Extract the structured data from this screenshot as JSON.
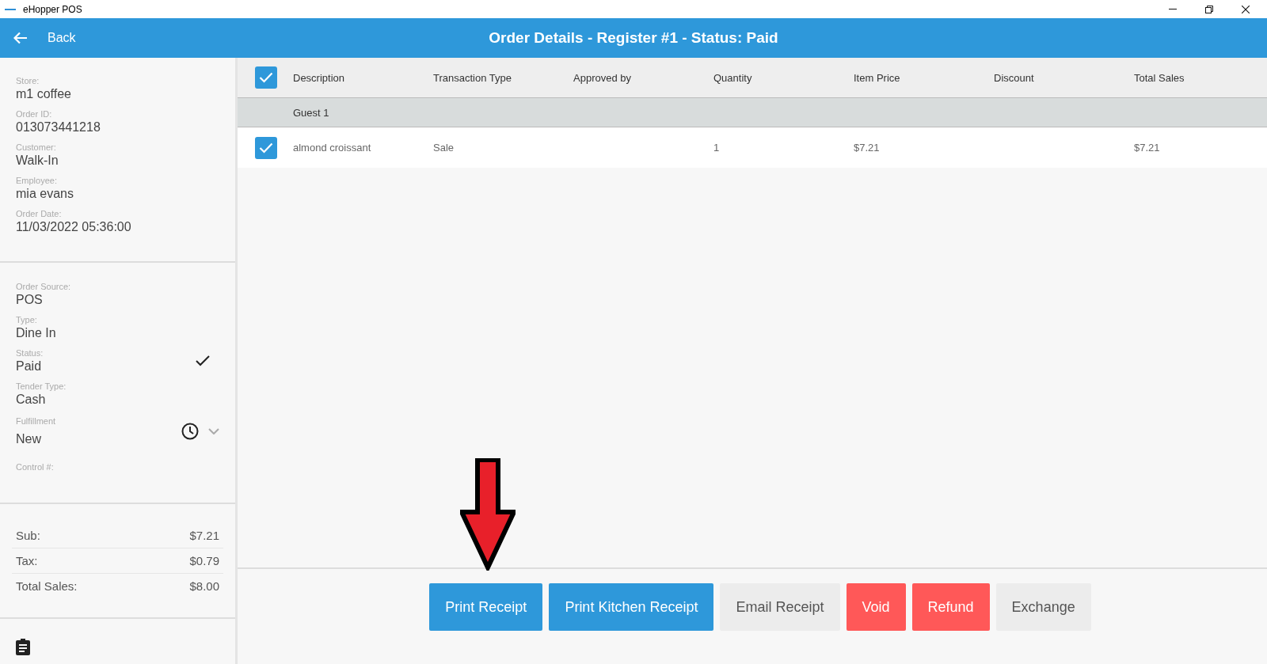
{
  "window": {
    "title": "eHopper POS"
  },
  "header": {
    "back": "Back",
    "title": "Order Details - Register #1 - Status: Paid"
  },
  "order_info": [
    {
      "label": "Store:",
      "value": "m1 coffee"
    },
    {
      "label": "Order ID:",
      "value": "013073441218"
    },
    {
      "label": "Customer:",
      "value": "Walk-In"
    },
    {
      "label": "Employee:",
      "value": "mia evans"
    },
    {
      "label": "Order Date:",
      "value": "11/03/2022 05:36:00"
    }
  ],
  "order_status": [
    {
      "label": "Order Source:",
      "value": "POS",
      "kind": "plain"
    },
    {
      "label": "Type:",
      "value": "Dine In",
      "kind": "plain"
    },
    {
      "label": "Status:",
      "value": "Paid",
      "kind": "check"
    },
    {
      "label": "Tender Type:",
      "value": "Cash",
      "kind": "plain"
    },
    {
      "label": "Fulfillment",
      "value": "New",
      "kind": "dropdown"
    },
    {
      "label": "Control #:",
      "kind": "plain"
    }
  ],
  "totals": [
    {
      "label": "Sub:",
      "value": "$7.21"
    },
    {
      "label": "Tax:",
      "value": "$0.79"
    },
    {
      "label": "Total Sales:",
      "value": "$8.00"
    }
  ],
  "table": {
    "select_all": {
      "checked": true
    },
    "columns": [
      "Description",
      "Transaction Type",
      "Approved by",
      "Quantity",
      "Item Price",
      "Discount",
      "Total Sales"
    ],
    "groups": [
      {
        "name": "Guest 1",
        "rows": [
          {
            "checked": true,
            "cells": [
              "almond croissant",
              "Sale",
              "",
              "1",
              "$7.21",
              "",
              "$7.21"
            ]
          }
        ]
      }
    ]
  },
  "actions": [
    {
      "label": "Print Receipt",
      "kind": "primary"
    },
    {
      "label": "Print Kitchen Receipt",
      "kind": "primary"
    },
    {
      "label": "Email Receipt",
      "kind": "neutral"
    },
    {
      "label": "Void",
      "kind": "danger"
    },
    {
      "label": "Refund",
      "kind": "danger"
    },
    {
      "label": "Exchange",
      "kind": "neutral"
    }
  ]
}
